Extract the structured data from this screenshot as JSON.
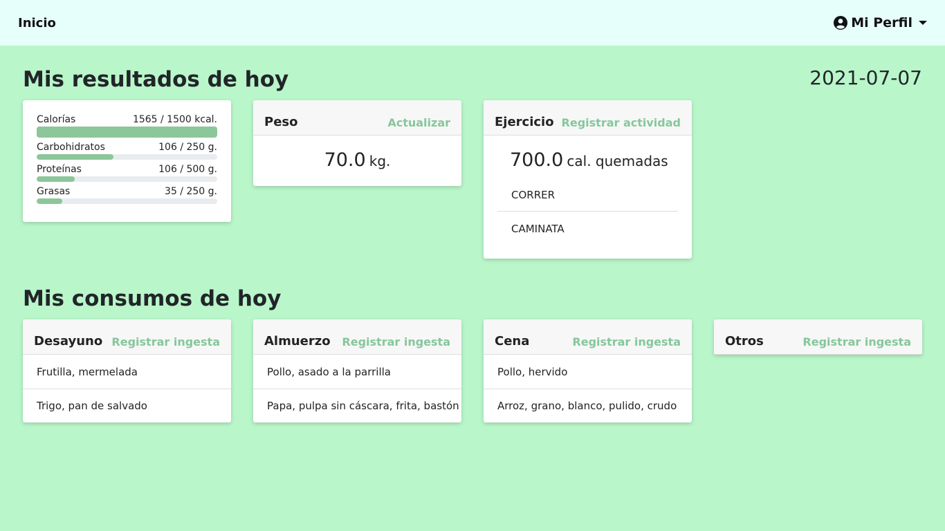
{
  "nav": {
    "brand": "Inicio",
    "profile_label": "Mi Perfil"
  },
  "results": {
    "title": "Mis resultados de hoy",
    "date": "2021-07-07",
    "stats": [
      {
        "label": "Calorías",
        "value": "1565 / 1500 kcal.",
        "fill": 1.0
      },
      {
        "label": "Carbohidratos",
        "value": "106 / 250 g.",
        "fill": 0.424
      },
      {
        "label": "Proteínas",
        "value": "106 / 500 g.",
        "fill": 0.212
      },
      {
        "label": "Grasas",
        "value": "35 / 250 g.",
        "fill": 0.14
      }
    ]
  },
  "peso": {
    "title": "Peso",
    "link": "Actualizar",
    "value": "70.0",
    "unit": "kg."
  },
  "ejercicio": {
    "title": "Ejercicio",
    "link": "Registrar actividad",
    "value": "700.0",
    "unit": "cal. quemadas",
    "activities": [
      "CORRER",
      "CAMINATA"
    ]
  },
  "consumos": {
    "title": "Mis consumos de hoy",
    "meals": [
      {
        "title": "Desayuno",
        "link": "Registrar ingesta",
        "items": [
          "Frutilla, mermelada",
          "Trigo, pan de salvado"
        ]
      },
      {
        "title": "Almuerzo",
        "link": "Registrar ingesta",
        "items": [
          "Pollo, asado a la parrilla",
          "Papa, pulpa sin cáscara, frita, bastón"
        ]
      },
      {
        "title": "Cena",
        "link": "Registrar ingesta",
        "items": [
          "Pollo, hervido",
          "Arroz, grano, blanco, pulido, crudo"
        ]
      },
      {
        "title": "Otros",
        "link": "Registrar ingesta",
        "items": []
      }
    ]
  },
  "colors": {
    "background": "#b9f6ca",
    "navbar": "#e6fffa",
    "accent": "#85c79b",
    "bar_fill": "#8cc69b"
  }
}
